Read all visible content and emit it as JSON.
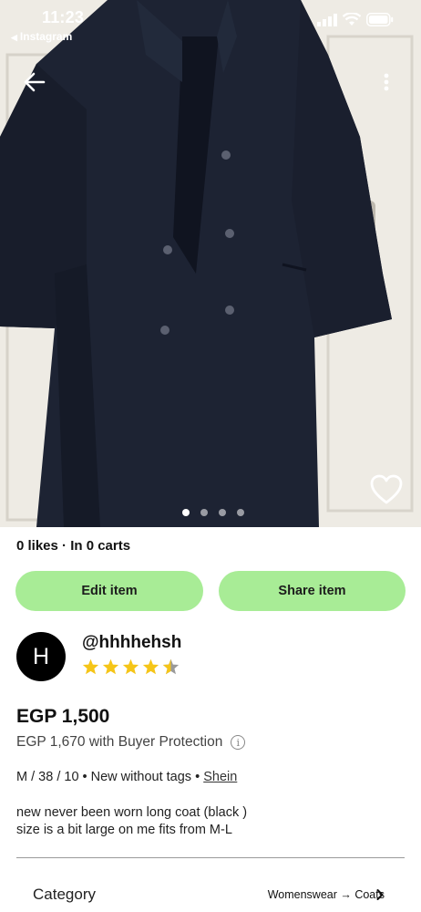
{
  "status_bar": {
    "time": "11:23",
    "back_app_label": "Instagram",
    "icons": [
      "signal-icon",
      "wifi-icon",
      "battery-icon"
    ]
  },
  "listing": {
    "photo": {
      "description_icon": "coat-photo",
      "page_count": 4,
      "active_page": 1
    },
    "stats": "0 likes · In 0 carts",
    "buttons": {
      "edit": "Edit item",
      "share": "Share item"
    },
    "seller": {
      "avatar_letter": "H",
      "username": "@hhhhehsh",
      "rating": 4.5
    },
    "price": "EGP 1,500",
    "price_with_protection": "EGP 1,670 with Buyer Protection",
    "meta": {
      "details": "M / 38 / 10 • New without tags •",
      "brand": "Shein"
    },
    "description": {
      "line1": "new never been worn long coat (black )",
      "line2": "size is a bit large on me fits from M-L"
    },
    "category": {
      "label": "Category",
      "value": "Womenswear → Coats"
    }
  },
  "colors": {
    "button_green": "#a8ec96",
    "star_yellow": "#f5c518",
    "avatar_bg": "#000000"
  }
}
